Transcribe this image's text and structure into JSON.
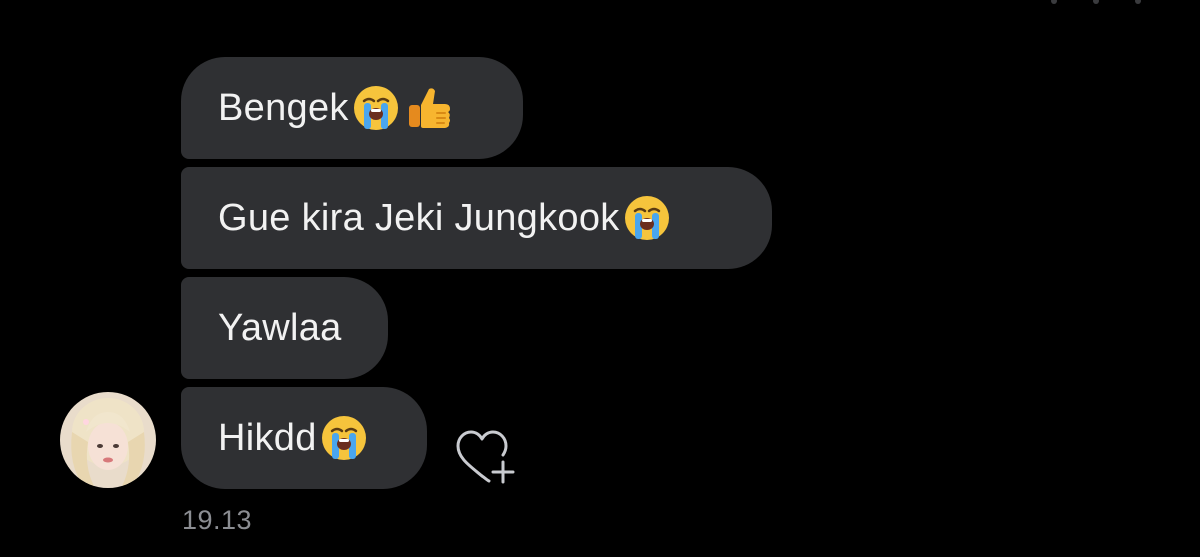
{
  "messages": [
    {
      "text": "Bengek",
      "emojis": [
        "loudly-crying-face-icon",
        "thumbs-up-icon"
      ]
    },
    {
      "text": "Gue kira Jeki Jungkook",
      "emojis": [
        "loudly-crying-face-icon"
      ]
    },
    {
      "text": "Yawlaa",
      "emojis": []
    },
    {
      "text": "Hikdd",
      "emojis": [
        "loudly-crying-face-icon"
      ]
    }
  ],
  "timestamp": "19.13",
  "colors": {
    "background": "#000000",
    "bubble": "#2f3033",
    "text": "#f2f2f2",
    "timestamp": "#8b8d92",
    "icon_stroke": "#c9cbd0"
  }
}
